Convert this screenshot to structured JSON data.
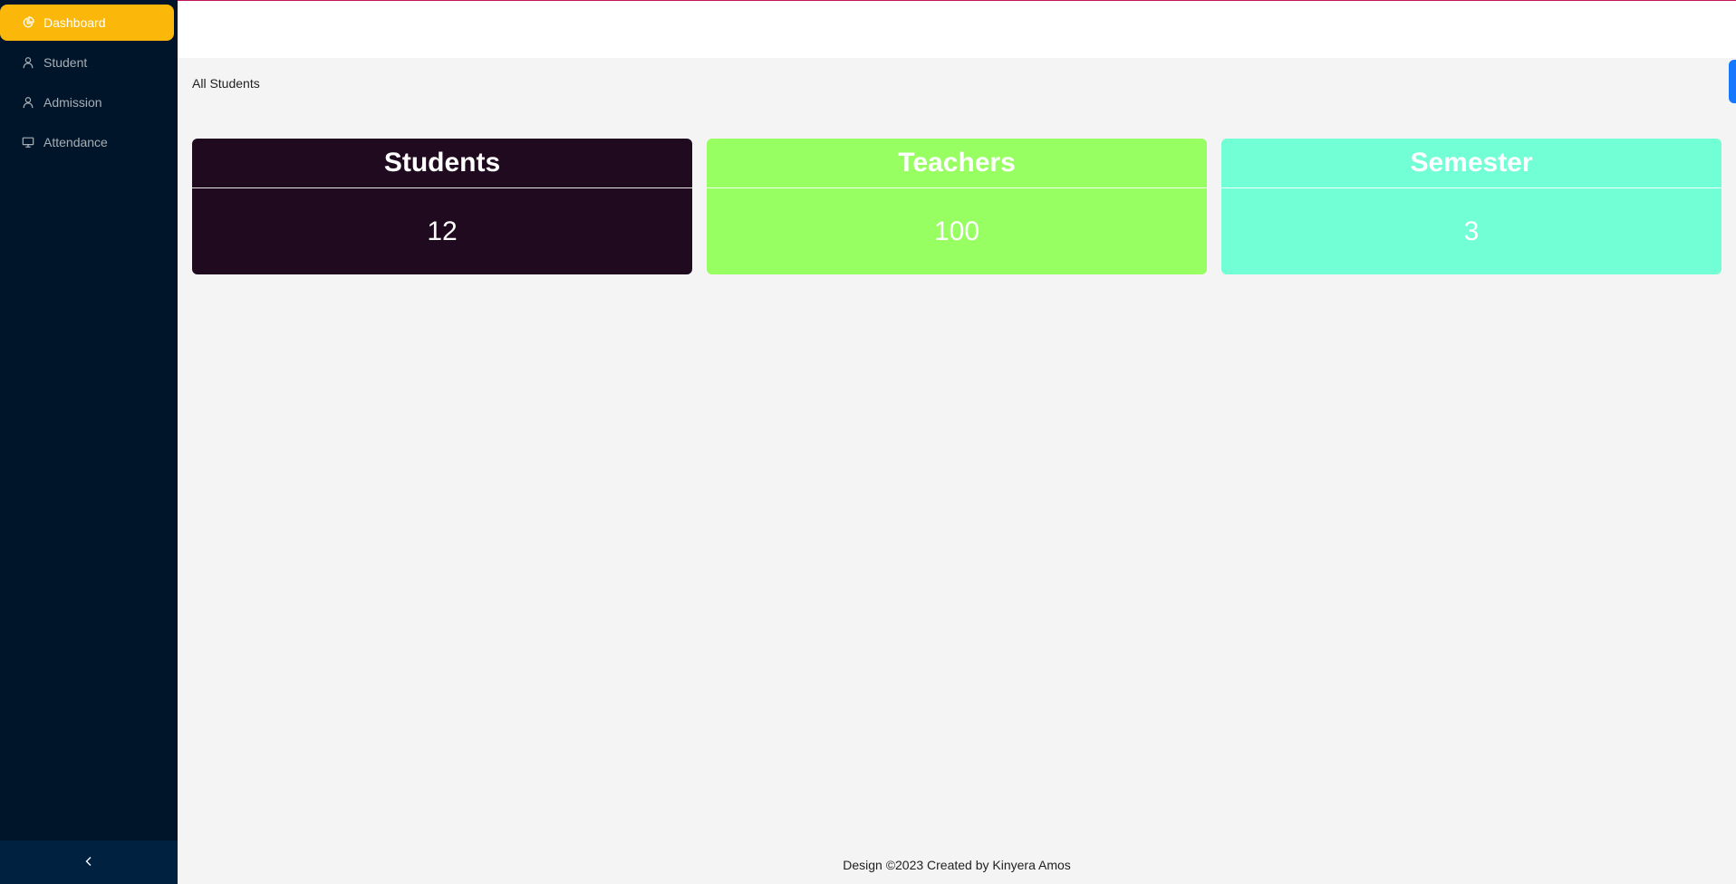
{
  "sidebar": {
    "items": [
      {
        "label": "Dashboard",
        "icon": "pie-chart-icon",
        "active": true
      },
      {
        "label": "Student",
        "icon": "user-icon",
        "active": false
      },
      {
        "label": "Admission",
        "icon": "user-icon",
        "active": false
      },
      {
        "label": "Attendance",
        "icon": "desktop-icon",
        "active": false
      }
    ],
    "collapse_icon": "chevron-left-icon",
    "active_color": "#fbb70a",
    "background": "#001529"
  },
  "breadcrumb": "All Students",
  "cards": [
    {
      "title": "Students",
      "value": "12",
      "color": "#200a20"
    },
    {
      "title": "Teachers",
      "value": "100",
      "color": "#97ff61"
    },
    {
      "title": "Semester",
      "value": "3",
      "color": "#72ffd5"
    }
  ],
  "footer": {
    "text": "Design ©2023 Created by Kinyera Amos"
  }
}
